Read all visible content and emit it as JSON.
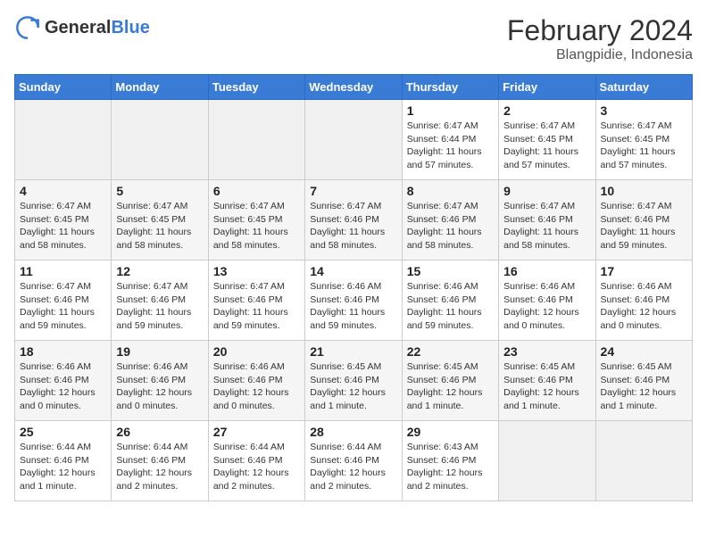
{
  "header": {
    "logo_general": "General",
    "logo_blue": "Blue",
    "month_year": "February 2024",
    "location": "Blangpidie, Indonesia"
  },
  "weekdays": [
    "Sunday",
    "Monday",
    "Tuesday",
    "Wednesday",
    "Thursday",
    "Friday",
    "Saturday"
  ],
  "weeks": [
    [
      {
        "day": "",
        "sunrise": "",
        "sunset": "",
        "daylight": ""
      },
      {
        "day": "",
        "sunrise": "",
        "sunset": "",
        "daylight": ""
      },
      {
        "day": "",
        "sunrise": "",
        "sunset": "",
        "daylight": ""
      },
      {
        "day": "",
        "sunrise": "",
        "sunset": "",
        "daylight": ""
      },
      {
        "day": "1",
        "sunrise": "Sunrise: 6:47 AM",
        "sunset": "Sunset: 6:44 PM",
        "daylight": "Daylight: 11 hours and 57 minutes."
      },
      {
        "day": "2",
        "sunrise": "Sunrise: 6:47 AM",
        "sunset": "Sunset: 6:45 PM",
        "daylight": "Daylight: 11 hours and 57 minutes."
      },
      {
        "day": "3",
        "sunrise": "Sunrise: 6:47 AM",
        "sunset": "Sunset: 6:45 PM",
        "daylight": "Daylight: 11 hours and 57 minutes."
      }
    ],
    [
      {
        "day": "4",
        "sunrise": "Sunrise: 6:47 AM",
        "sunset": "Sunset: 6:45 PM",
        "daylight": "Daylight: 11 hours and 58 minutes."
      },
      {
        "day": "5",
        "sunrise": "Sunrise: 6:47 AM",
        "sunset": "Sunset: 6:45 PM",
        "daylight": "Daylight: 11 hours and 58 minutes."
      },
      {
        "day": "6",
        "sunrise": "Sunrise: 6:47 AM",
        "sunset": "Sunset: 6:45 PM",
        "daylight": "Daylight: 11 hours and 58 minutes."
      },
      {
        "day": "7",
        "sunrise": "Sunrise: 6:47 AM",
        "sunset": "Sunset: 6:46 PM",
        "daylight": "Daylight: 11 hours and 58 minutes."
      },
      {
        "day": "8",
        "sunrise": "Sunrise: 6:47 AM",
        "sunset": "Sunset: 6:46 PM",
        "daylight": "Daylight: 11 hours and 58 minutes."
      },
      {
        "day": "9",
        "sunrise": "Sunrise: 6:47 AM",
        "sunset": "Sunset: 6:46 PM",
        "daylight": "Daylight: 11 hours and 58 minutes."
      },
      {
        "day": "10",
        "sunrise": "Sunrise: 6:47 AM",
        "sunset": "Sunset: 6:46 PM",
        "daylight": "Daylight: 11 hours and 59 minutes."
      }
    ],
    [
      {
        "day": "11",
        "sunrise": "Sunrise: 6:47 AM",
        "sunset": "Sunset: 6:46 PM",
        "daylight": "Daylight: 11 hours and 59 minutes."
      },
      {
        "day": "12",
        "sunrise": "Sunrise: 6:47 AM",
        "sunset": "Sunset: 6:46 PM",
        "daylight": "Daylight: 11 hours and 59 minutes."
      },
      {
        "day": "13",
        "sunrise": "Sunrise: 6:47 AM",
        "sunset": "Sunset: 6:46 PM",
        "daylight": "Daylight: 11 hours and 59 minutes."
      },
      {
        "day": "14",
        "sunrise": "Sunrise: 6:46 AM",
        "sunset": "Sunset: 6:46 PM",
        "daylight": "Daylight: 11 hours and 59 minutes."
      },
      {
        "day": "15",
        "sunrise": "Sunrise: 6:46 AM",
        "sunset": "Sunset: 6:46 PM",
        "daylight": "Daylight: 11 hours and 59 minutes."
      },
      {
        "day": "16",
        "sunrise": "Sunrise: 6:46 AM",
        "sunset": "Sunset: 6:46 PM",
        "daylight": "Daylight: 12 hours and 0 minutes."
      },
      {
        "day": "17",
        "sunrise": "Sunrise: 6:46 AM",
        "sunset": "Sunset: 6:46 PM",
        "daylight": "Daylight: 12 hours and 0 minutes."
      }
    ],
    [
      {
        "day": "18",
        "sunrise": "Sunrise: 6:46 AM",
        "sunset": "Sunset: 6:46 PM",
        "daylight": "Daylight: 12 hours and 0 minutes."
      },
      {
        "day": "19",
        "sunrise": "Sunrise: 6:46 AM",
        "sunset": "Sunset: 6:46 PM",
        "daylight": "Daylight: 12 hours and 0 minutes."
      },
      {
        "day": "20",
        "sunrise": "Sunrise: 6:46 AM",
        "sunset": "Sunset: 6:46 PM",
        "daylight": "Daylight: 12 hours and 0 minutes."
      },
      {
        "day": "21",
        "sunrise": "Sunrise: 6:45 AM",
        "sunset": "Sunset: 6:46 PM",
        "daylight": "Daylight: 12 hours and 1 minute."
      },
      {
        "day": "22",
        "sunrise": "Sunrise: 6:45 AM",
        "sunset": "Sunset: 6:46 PM",
        "daylight": "Daylight: 12 hours and 1 minute."
      },
      {
        "day": "23",
        "sunrise": "Sunrise: 6:45 AM",
        "sunset": "Sunset: 6:46 PM",
        "daylight": "Daylight: 12 hours and 1 minute."
      },
      {
        "day": "24",
        "sunrise": "Sunrise: 6:45 AM",
        "sunset": "Sunset: 6:46 PM",
        "daylight": "Daylight: 12 hours and 1 minute."
      }
    ],
    [
      {
        "day": "25",
        "sunrise": "Sunrise: 6:44 AM",
        "sunset": "Sunset: 6:46 PM",
        "daylight": "Daylight: 12 hours and 1 minute."
      },
      {
        "day": "26",
        "sunrise": "Sunrise: 6:44 AM",
        "sunset": "Sunset: 6:46 PM",
        "daylight": "Daylight: 12 hours and 2 minutes."
      },
      {
        "day": "27",
        "sunrise": "Sunrise: 6:44 AM",
        "sunset": "Sunset: 6:46 PM",
        "daylight": "Daylight: 12 hours and 2 minutes."
      },
      {
        "day": "28",
        "sunrise": "Sunrise: 6:44 AM",
        "sunset": "Sunset: 6:46 PM",
        "daylight": "Daylight: 12 hours and 2 minutes."
      },
      {
        "day": "29",
        "sunrise": "Sunrise: 6:43 AM",
        "sunset": "Sunset: 6:46 PM",
        "daylight": "Daylight: 12 hours and 2 minutes."
      },
      {
        "day": "",
        "sunrise": "",
        "sunset": "",
        "daylight": ""
      },
      {
        "day": "",
        "sunrise": "",
        "sunset": "",
        "daylight": ""
      }
    ]
  ]
}
